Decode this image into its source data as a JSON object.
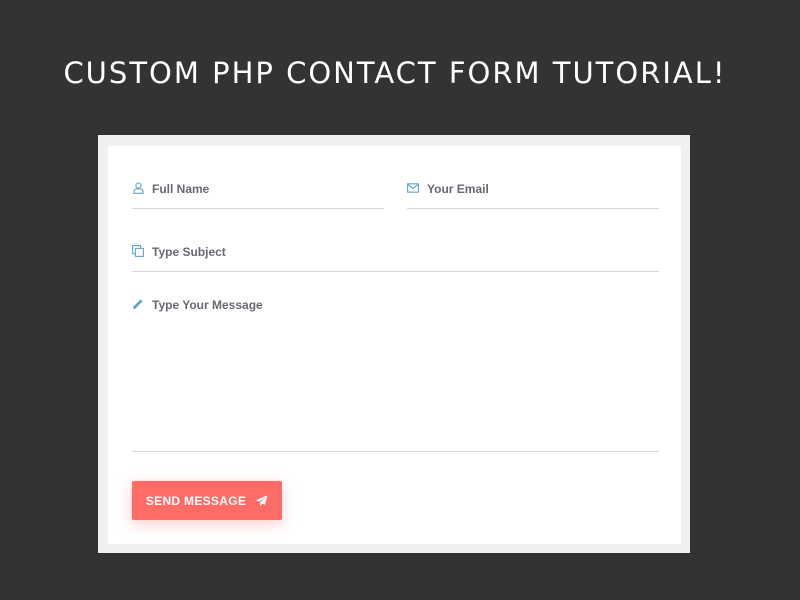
{
  "title": "CUSTOM PHP CONTACT FORM TUTORIAL!",
  "form": {
    "full_name": {
      "placeholder": "Full Name",
      "icon": "user-icon",
      "value": ""
    },
    "email": {
      "placeholder": "Your Email",
      "icon": "envelope-icon",
      "value": ""
    },
    "subject": {
      "placeholder": "Type Subject",
      "icon": "copy-icon",
      "value": ""
    },
    "message": {
      "placeholder": "Type Your Message",
      "icon": "pencil-icon",
      "value": ""
    },
    "submit": {
      "label": "SEND MESSAGE",
      "icon": "paper-plane-icon"
    }
  },
  "colors": {
    "background": "#333333",
    "card": "#ffffff",
    "accent": "#ff6b66",
    "icon": "#5aa9c9",
    "placeholder_text": "#666a70",
    "underline": "#d6d6d6"
  }
}
